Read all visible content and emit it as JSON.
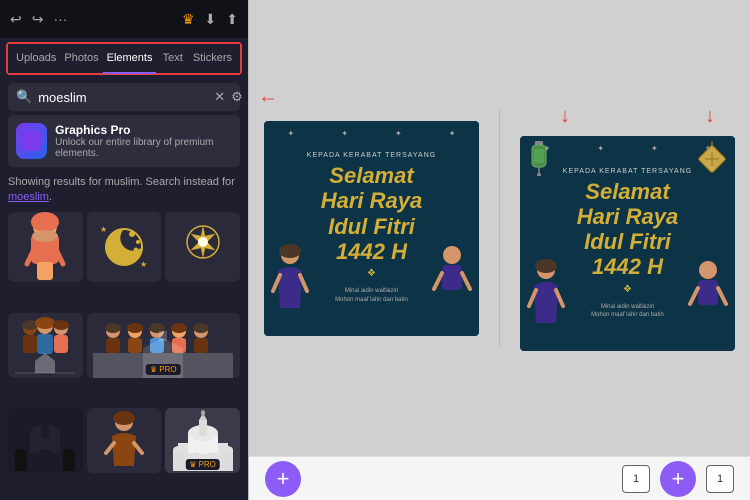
{
  "toolbar": {
    "icons": [
      "↩",
      "↩",
      "⋯",
      "👑",
      "⬇",
      "⬆"
    ]
  },
  "nav": {
    "tabs": [
      {
        "id": "uploads",
        "label": "Uploads"
      },
      {
        "id": "photos",
        "label": "Photos"
      },
      {
        "id": "elements",
        "label": "Elements",
        "active": true
      },
      {
        "id": "text",
        "label": "Text"
      },
      {
        "id": "stickers",
        "label": "Stickers"
      }
    ]
  },
  "search": {
    "query": "moeslim",
    "placeholder": "moeslim",
    "filter_icon": "⚙",
    "clear_icon": "✕"
  },
  "graphics_pro": {
    "title": "Graphics Pro",
    "subtitle": "Unlock our entire library of premium elements.",
    "icon": "🖼"
  },
  "results_text": {
    "line1": "Showing results for muslim. Search instead for",
    "link": "moeslim",
    "period": "."
  },
  "elements": [
    {
      "id": "hijab-girl",
      "type": "emoji",
      "content": "🧕",
      "pro": false
    },
    {
      "id": "crescent",
      "type": "emoji",
      "content": "🌙",
      "pro": false
    },
    {
      "id": "star-lamp",
      "type": "emoji",
      "content": "🌟",
      "pro": false
    },
    {
      "id": "family",
      "type": "emoji",
      "content": "👨‍👩‍👧",
      "pro": false
    },
    {
      "id": "kids-row",
      "type": "emoji",
      "content": "👧👦👧👦",
      "pro": true,
      "wide": true
    },
    {
      "id": "mosque-dark",
      "type": "emoji",
      "content": "🕌",
      "pro": false
    },
    {
      "id": "praying-girl",
      "type": "emoji",
      "content": "🧎‍♀️",
      "pro": false
    },
    {
      "id": "mosque-white",
      "type": "emoji",
      "content": "🕌",
      "pro": true
    }
  ],
  "design_card": {
    "subtitle": "KEPADA KERABAT TERSAYANG",
    "title_line1": "Selamat",
    "title_line2": "Hari Raya",
    "title_line3": "Idul Fitri",
    "title_line4": "1442 H",
    "footer_line1": "Minal aidin walfaizin",
    "footer_line2": "Mohon maaf lahir dan batin",
    "divider": "❖"
  },
  "bottom_bar": {
    "add_icon": "+",
    "page_number": "1"
  },
  "arrows": {
    "down": "↓",
    "left_arrow": "←"
  }
}
